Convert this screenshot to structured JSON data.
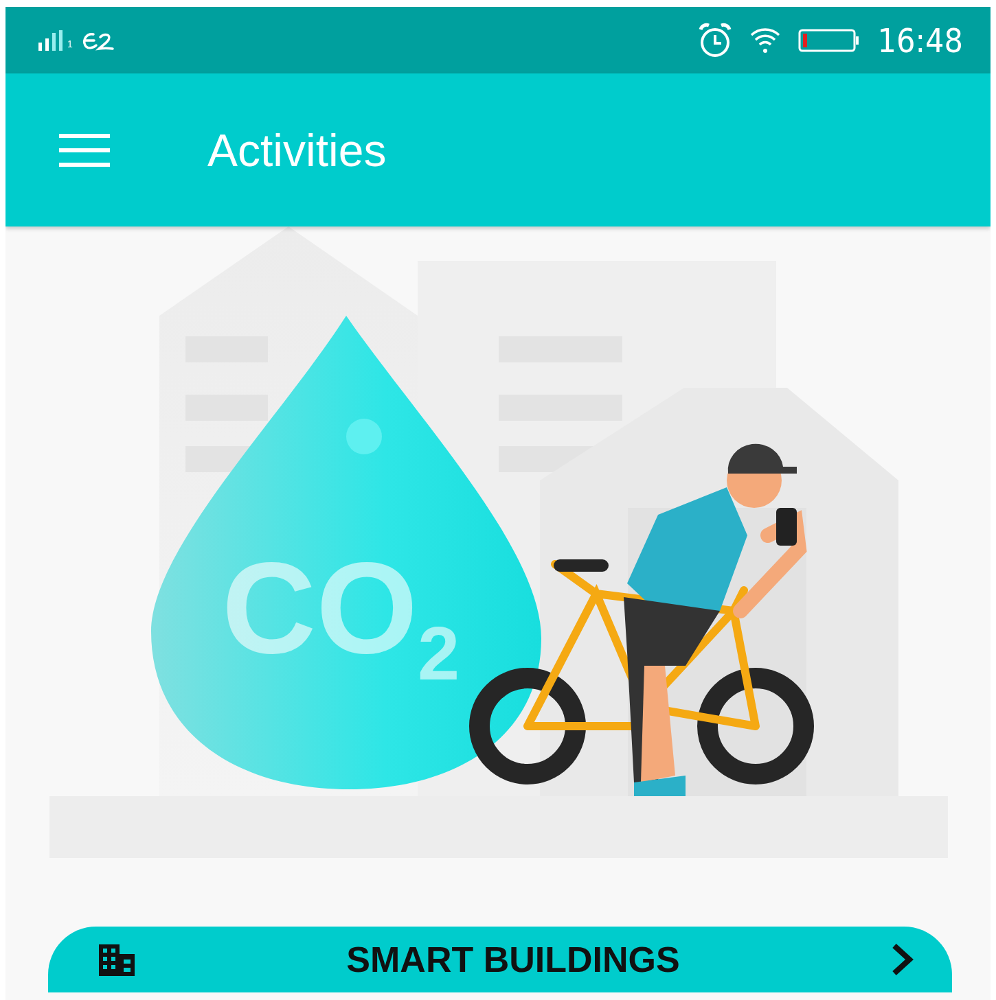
{
  "status_bar": {
    "sim_label": "1",
    "time": "16:48"
  },
  "app_bar": {
    "title": "Activities"
  },
  "illustration": {
    "text": "CO$_{2}$"
  },
  "buttons": [
    {
      "label": "SMART BUILDINGS"
    }
  ]
}
